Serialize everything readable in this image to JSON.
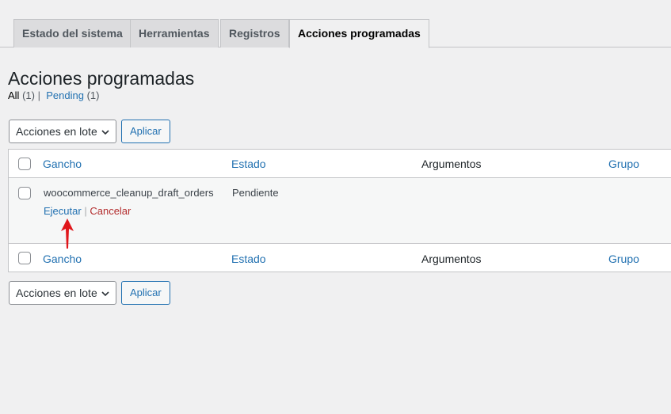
{
  "tabs": [
    {
      "label": "Estado del sistema",
      "active": false
    },
    {
      "label": "Herramientas",
      "active": false
    },
    {
      "label": "Registros",
      "active": false
    },
    {
      "label": "Acciones programadas",
      "active": true
    }
  ],
  "page": {
    "title": "Acciones programadas"
  },
  "filters": {
    "all_label": "All",
    "all_count": "(1)",
    "separator": "|",
    "pending_label": "Pending",
    "pending_count": "(1)"
  },
  "bulk": {
    "select_value": "Acciones en lote",
    "apply_label": "Aplicar"
  },
  "table": {
    "columns": [
      "Gancho",
      "Estado",
      "Argumentos",
      "Grupo"
    ],
    "rows": [
      {
        "hook": "woocommerce_cleanup_draft_orders",
        "status": "Pendiente",
        "arguments": "",
        "group": "",
        "actions": {
          "run": "Ejecutar",
          "separator": "|",
          "cancel": "Cancelar"
        }
      }
    ]
  },
  "colors": {
    "link": "#2271b1",
    "danger": "#b32d2e",
    "annotation_arrow": "#e0161b",
    "background": "#f0f0f1"
  },
  "icons": {
    "select_chevron": "chevron-down-icon",
    "annotation": "red-arrow-up-icon"
  }
}
